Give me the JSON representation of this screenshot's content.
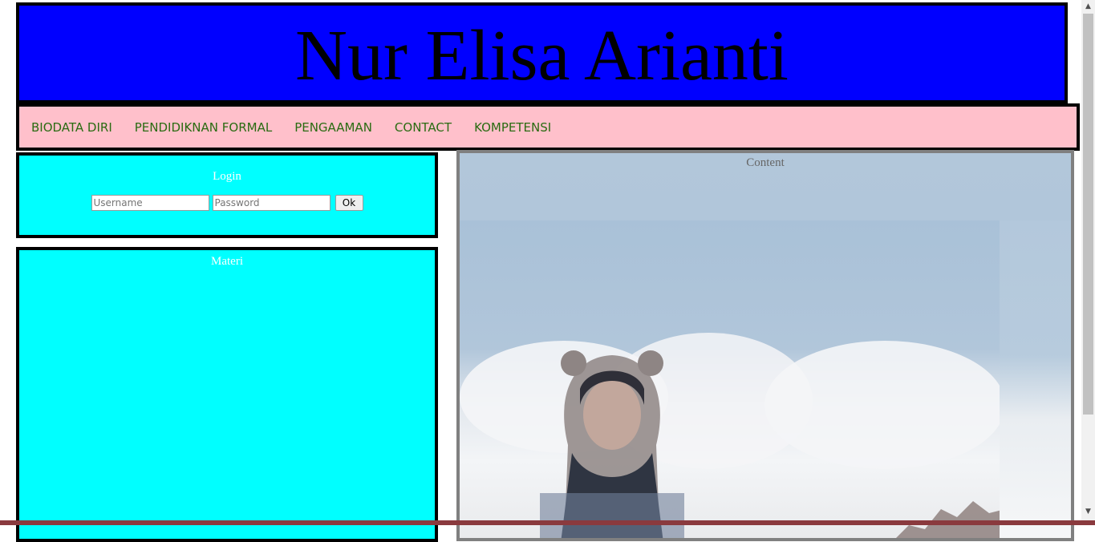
{
  "header": {
    "title": "Nur Elisa Arianti"
  },
  "nav": {
    "items": [
      {
        "label": "BIODATA DIRI"
      },
      {
        "label": "PENDIDIKNAN FORMAL"
      },
      {
        "label": "PENGAAMAN"
      },
      {
        "label": "CONTACT"
      },
      {
        "label": "KOMPETENSI"
      }
    ]
  },
  "login": {
    "title": "Login",
    "username_placeholder": "Username",
    "password_placeholder": "Password",
    "submit_label": "Ok"
  },
  "materi": {
    "title": "Materi"
  },
  "content": {
    "title": "Content"
  },
  "colors": {
    "header_bg": "#0000ff",
    "nav_bg": "#ffc0cb",
    "nav_text": "#2a6b12",
    "sidebar_bg": "#00ffff",
    "content_border": "#808080"
  },
  "icons": {
    "scroll_up": "chevron-up-icon",
    "scroll_down": "chevron-down-icon"
  }
}
